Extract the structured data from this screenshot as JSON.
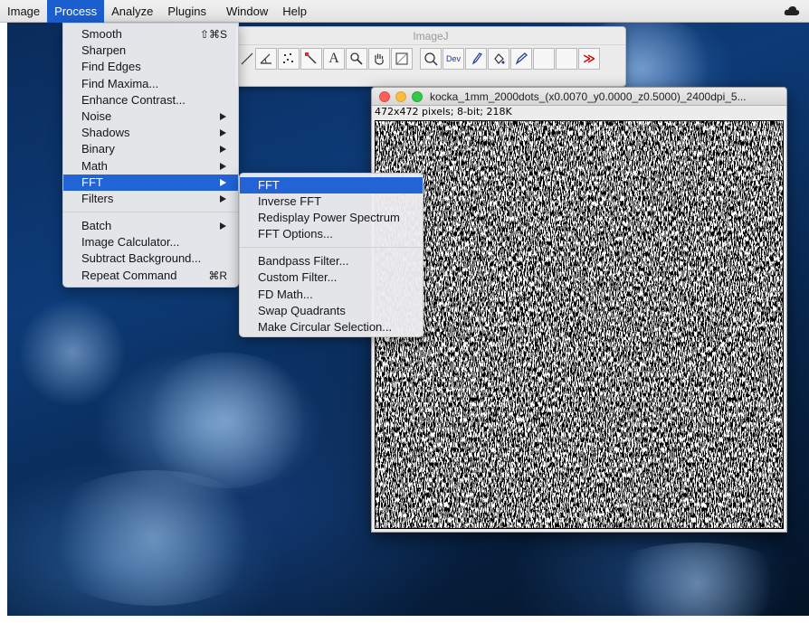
{
  "menubar": {
    "items": [
      "Image",
      "Process",
      "Analyze",
      "Plugins",
      "Window",
      "Help"
    ],
    "active": "Process"
  },
  "imagej_toolbar": {
    "title": "ImageJ",
    "dev_label": "Dev",
    "more_symbol": "≫"
  },
  "process_menu": {
    "items": [
      {
        "label": "Smooth",
        "shortcut": "⇧⌘S"
      },
      {
        "label": "Sharpen"
      },
      {
        "label": "Find Edges"
      },
      {
        "label": "Find Maxima..."
      },
      {
        "label": "Enhance Contrast..."
      },
      {
        "label": "Noise",
        "submenu": true
      },
      {
        "label": "Shadows",
        "submenu": true
      },
      {
        "label": "Binary",
        "submenu": true
      },
      {
        "label": "Math",
        "submenu": true
      },
      {
        "label": "FFT",
        "submenu": true,
        "highlighted": true
      },
      {
        "label": "Filters",
        "submenu": true
      },
      {
        "label": "Batch",
        "submenu": true
      },
      {
        "label": "Image Calculator..."
      },
      {
        "label": "Subtract Background..."
      },
      {
        "label": "Repeat Command",
        "shortcut": "⌘R"
      }
    ]
  },
  "fft_menu": {
    "items": [
      {
        "label": "FFT",
        "highlighted": true
      },
      {
        "label": "Inverse FFT"
      },
      {
        "label": "Redisplay Power Spectrum"
      },
      {
        "label": "FFT Options..."
      },
      {
        "label": "Bandpass Filter..."
      },
      {
        "label": "Custom Filter..."
      },
      {
        "label": "FD Math..."
      },
      {
        "label": "Swap Quadrants"
      },
      {
        "label": "Make Circular Selection..."
      }
    ]
  },
  "image_window": {
    "title": "kocka_1mm_2000dots_(x0.0070_y0.0000_z0.5000)_2400dpi_5...",
    "info": "472x472 pixels; 8-bit; 218K"
  },
  "colors": {
    "menu_highlight": "#2263d6",
    "menubar_active": "#1b5fce",
    "traffic_red": "#fc605c",
    "traffic_yellow": "#fdbc40",
    "traffic_green": "#34c84a"
  }
}
